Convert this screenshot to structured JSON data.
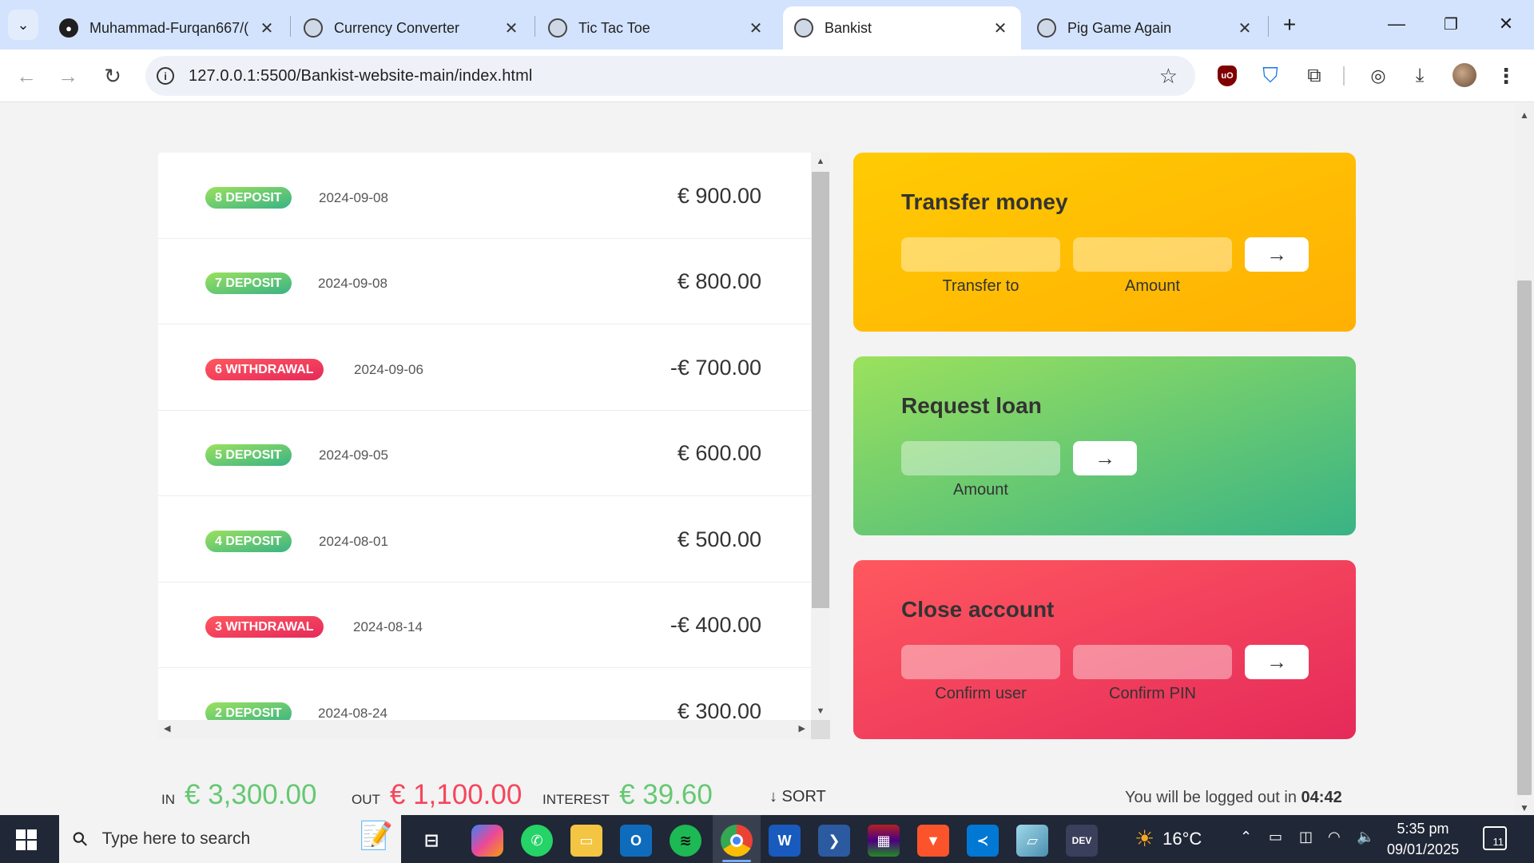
{
  "browser": {
    "tabs": [
      {
        "title": "Muhammad-Furqan667/(",
        "icon": "github-icon"
      },
      {
        "title": "Currency Converter",
        "icon": "globe-icon"
      },
      {
        "title": "Tic Tac Toe",
        "icon": "globe-icon"
      },
      {
        "title": "Bankist",
        "icon": "globe-icon"
      },
      {
        "title": "Pig Game Again",
        "icon": "globe-icon"
      }
    ],
    "active_tab": "Bankist",
    "url": "127.0.0.1:5500/Bankist-website-main/index.html"
  },
  "movements": [
    {
      "type": "8 DEPOSIT",
      "kind": "deposit",
      "date": "2024-09-08",
      "value": "€ 900.00"
    },
    {
      "type": "7 DEPOSIT",
      "kind": "deposit",
      "date": "2024-09-08",
      "value": "€ 800.00"
    },
    {
      "type": "6 WITHDRAWAL",
      "kind": "withdrawal",
      "date": "2024-09-06",
      "value": "-€ 700.00"
    },
    {
      "type": "5 DEPOSIT",
      "kind": "deposit",
      "date": "2024-09-05",
      "value": "€ 600.00"
    },
    {
      "type": "4 DEPOSIT",
      "kind": "deposit",
      "date": "2024-08-01",
      "value": "€ 500.00"
    },
    {
      "type": "3 WITHDRAWAL",
      "kind": "withdrawal",
      "date": "2024-08-14",
      "value": "-€ 400.00"
    },
    {
      "type": "2 DEPOSIT",
      "kind": "deposit",
      "date": "2024-08-24",
      "value": "€ 300.00"
    }
  ],
  "operations": {
    "transfer": {
      "title": "Transfer money",
      "label_to": "Transfer to",
      "label_amount": "Amount",
      "button": "→"
    },
    "loan": {
      "title": "Request loan",
      "label_amount": "Amount",
      "button": "→"
    },
    "close": {
      "title": "Close account",
      "label_user": "Confirm user",
      "label_pin": "Confirm PIN",
      "button": "→"
    }
  },
  "summary": {
    "in_label": "In",
    "in_value": "€ 3,300.00",
    "out_label": "Out",
    "out_value": "€ 1,100.00",
    "interest_label": "Interest",
    "interest_value": "€ 39.60",
    "sort_label": "↓ SORT"
  },
  "logout": {
    "text": "You will be logged out in",
    "timer": "04:42"
  },
  "taskbar": {
    "search_placeholder": "Type here to search",
    "weather": "16°C",
    "time": "5:35 pm",
    "date": "09/01/2025",
    "notifications": "11"
  },
  "colors": {
    "deposit": "#39b385",
    "withdrawal": "#e52a5a",
    "transfer": "#ffb003",
    "in_value": "#66c873",
    "out_value": "#f5465d"
  }
}
